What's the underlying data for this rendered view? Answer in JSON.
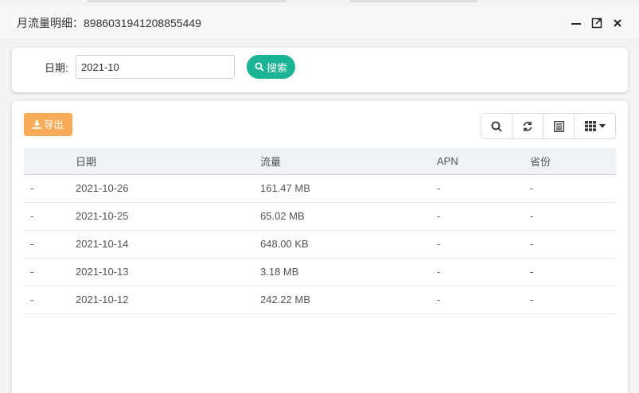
{
  "dialog": {
    "title": "月流量明细：8986031941208855449"
  },
  "search": {
    "label": "日期:",
    "date_value": "2021-10",
    "button_label": "搜索"
  },
  "toolbar": {
    "export_label": "导出"
  },
  "table": {
    "headers": [
      "",
      "日期",
      "流量",
      "APN",
      "省份"
    ],
    "rows": [
      [
        "-",
        "2021-10-26",
        "161.47 MB",
        "-",
        "-"
      ],
      [
        "-",
        "2021-10-25",
        "65.02 MB",
        "-",
        "-"
      ],
      [
        "-",
        "2021-10-14",
        "648.00 KB",
        "-",
        "-"
      ],
      [
        "-",
        "2021-10-13",
        "3.18 MB",
        "-",
        "-"
      ],
      [
        "-",
        "2021-10-12",
        "242.22 MB",
        "-",
        "-"
      ]
    ]
  },
  "colors": {
    "primary": "#1ab394",
    "warning": "#f8ac59",
    "header_bg": "#eff2f7"
  }
}
